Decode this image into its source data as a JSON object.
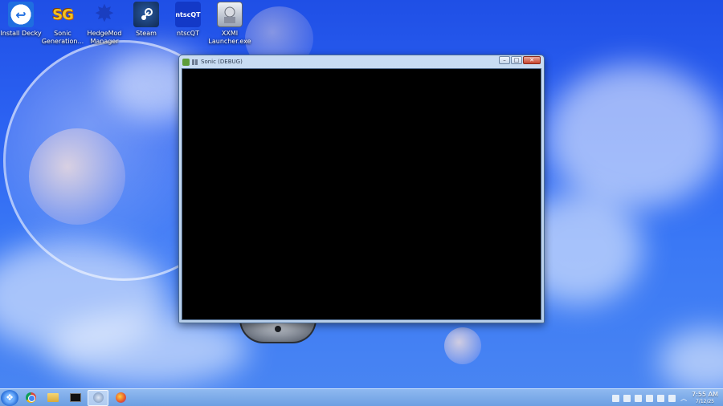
{
  "desktop": {
    "icons": [
      {
        "label": "Install Decky",
        "icon": "decky-icon"
      },
      {
        "label": "Sonic Generation...",
        "icon": "sonic-generations-icon"
      },
      {
        "label": "HedgeMod Manager",
        "icon": "hedgemod-icon"
      },
      {
        "label": "Steam",
        "icon": "steam-icon"
      },
      {
        "label": "ntscQT",
        "icon": "ntscqt-icon"
      },
      {
        "label": "XXMI Launcher.exe",
        "icon": "xxmi-icon"
      }
    ],
    "icon_glyphs": {
      "sg": "SG",
      "ntsc": "ntscQT"
    }
  },
  "window": {
    "title": "Sonic (DEBUG)",
    "buttons": {
      "minimize": "–",
      "maximize": "□",
      "close": "✕"
    }
  },
  "taskbar": {
    "items": [
      "start",
      "chrome",
      "file-explorer",
      "terminal",
      "steam",
      "firefox"
    ],
    "active_item": "steam",
    "clock": {
      "time": "7:55 AM",
      "date": "7/12/25"
    }
  },
  "colors": {
    "accent": "#2c62f2",
    "window_frame": "#b5cde9",
    "close": "#c7432c"
  }
}
